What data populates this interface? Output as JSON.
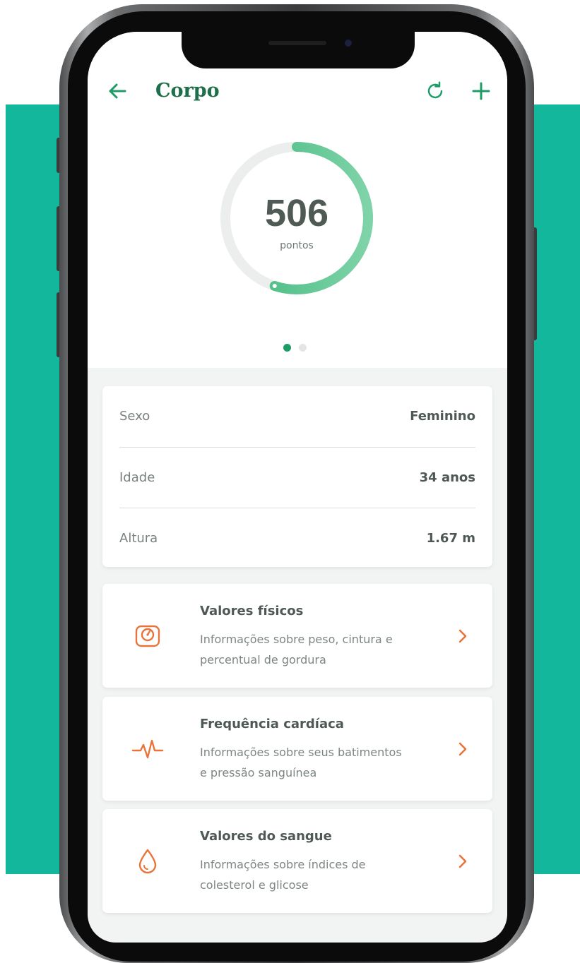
{
  "header": {
    "title": "Corpo",
    "back_icon": "arrow-left-icon",
    "refresh_icon": "refresh-icon",
    "add_icon": "plus-icon"
  },
  "score": {
    "value": "506",
    "unit": "pontos",
    "progress_fraction": 0.55
  },
  "pager": {
    "count": 2,
    "active_index": 0
  },
  "profile": {
    "rows": [
      {
        "label": "Sexo",
        "value": "Feminino"
      },
      {
        "label": "Idade",
        "value": "34 anos"
      },
      {
        "label": "Altura",
        "value": "1.67 m"
      }
    ]
  },
  "features": [
    {
      "icon": "scale-icon",
      "title": "Valores físicos",
      "desc_line1": "Informações sobre peso, cintura e",
      "desc_line2": "percentual de gordura"
    },
    {
      "icon": "heartbeat-icon",
      "title": "Frequência cardíaca",
      "desc_line1": "Informações sobre seus batimentos",
      "desc_line2": "e pressão sanguínea"
    },
    {
      "icon": "blood-drop-icon",
      "title": "Valores do sangue",
      "desc_line1": "Informações sobre índices de",
      "desc_line2": "colesterol e glicose"
    }
  ],
  "colors": {
    "brand_green": "#1e6e49",
    "accent_green": "#1e9c67",
    "ring_green": "#5cc48f",
    "ring_track": "#eceeed",
    "icon_orange": "#e8743b",
    "background_band": "#13b79c"
  }
}
